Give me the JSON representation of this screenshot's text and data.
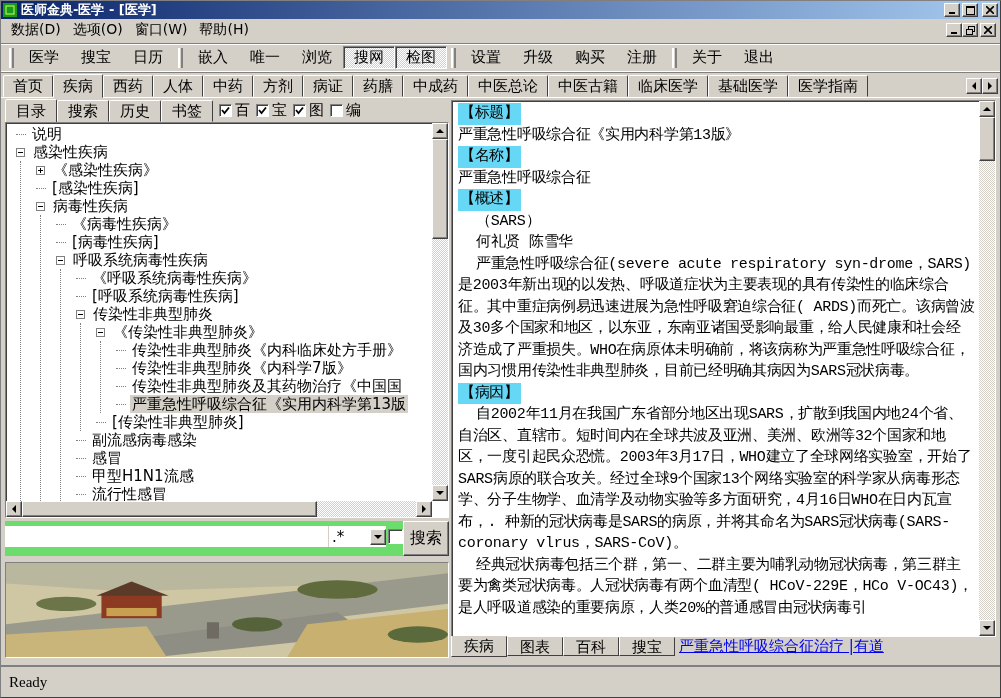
{
  "window": {
    "title": "医师金典-医学 - [医学]"
  },
  "menu": [
    "数据(D)",
    "选项(O)",
    "窗口(W)",
    "帮助(H)"
  ],
  "toolbar": [
    {
      "buttons": [
        {
          "label": "医学",
          "pressed": false
        },
        {
          "label": "搜宝",
          "pressed": false
        },
        {
          "label": "日历",
          "pressed": false
        }
      ]
    },
    {
      "buttons": [
        {
          "label": "嵌入",
          "pressed": false
        },
        {
          "label": "唯一",
          "pressed": false
        },
        {
          "label": "浏览",
          "pressed": false
        },
        {
          "label": "搜网",
          "pressed": true
        },
        {
          "label": "检图",
          "pressed": true
        }
      ]
    },
    {
      "buttons": [
        {
          "label": "设置",
          "pressed": false
        },
        {
          "label": "升级",
          "pressed": false
        },
        {
          "label": "购买",
          "pressed": false
        },
        {
          "label": "注册",
          "pressed": false
        }
      ]
    },
    {
      "buttons": [
        {
          "label": "关于",
          "pressed": false
        },
        {
          "label": "退出",
          "pressed": false
        }
      ]
    }
  ],
  "tabs": [
    {
      "label": "首页",
      "selected": false
    },
    {
      "label": "疾病",
      "selected": true
    },
    {
      "label": "西药",
      "selected": false
    },
    {
      "label": "人体",
      "selected": false
    },
    {
      "label": "中药",
      "selected": false
    },
    {
      "label": "方剂",
      "selected": false
    },
    {
      "label": "病证",
      "selected": false
    },
    {
      "label": "药膳",
      "selected": false
    },
    {
      "label": "中成药",
      "selected": false
    },
    {
      "label": "中医总论",
      "selected": false
    },
    {
      "label": "中医古籍",
      "selected": false
    },
    {
      "label": "临床医学",
      "selected": false
    },
    {
      "label": "基础医学",
      "selected": false
    },
    {
      "label": "医学指南",
      "selected": false
    }
  ],
  "left_tabs": [
    {
      "label": "目录",
      "selected": true
    },
    {
      "label": "搜索",
      "selected": false
    },
    {
      "label": "历史",
      "selected": false
    },
    {
      "label": "书签",
      "selected": false
    }
  ],
  "options": [
    {
      "label": "百",
      "checked": true
    },
    {
      "label": "宝",
      "checked": true
    },
    {
      "label": "图",
      "checked": true
    },
    {
      "label": "编",
      "checked": false
    }
  ],
  "tree": [
    {
      "label": "说明",
      "selected": false
    },
    {
      "label": "感染性疾病",
      "selected": false,
      "expanded": true,
      "children": [
        {
          "label": "《感染性疾病》",
          "selected": false,
          "expanded": false
        },
        {
          "label": "[感染性疾病]",
          "selected": false
        },
        {
          "label": "病毒性疾病",
          "selected": false,
          "expanded": true,
          "children": [
            {
              "label": "《病毒性疾病》",
              "selected": false
            },
            {
              "label": "[病毒性疾病]",
              "selected": false
            },
            {
              "label": "呼吸系统病毒性疾病",
              "selected": false,
              "expanded": true,
              "children": [
                {
                  "label": "《呼吸系统病毒性疾病》",
                  "selected": false
                },
                {
                  "label": "[呼吸系统病毒性疾病]",
                  "selected": false
                },
                {
                  "label": "传染性非典型肺炎",
                  "selected": false,
                  "expanded": true,
                  "children": [
                    {
                      "label": "《传染性非典型肺炎》",
                      "selected": false,
                      "expanded": true,
                      "children": [
                        {
                          "label": "传染性非典型肺炎《内科临床处方手册》",
                          "selected": false
                        },
                        {
                          "label": "传染性非典型肺炎《内科学7版》",
                          "selected": false
                        },
                        {
                          "label": "传染性非典型肺炎及其药物治疗《中国国",
                          "selected": false
                        },
                        {
                          "label": "严重急性呼吸综合征《实用内科学第13版",
                          "selected": true
                        }
                      ]
                    },
                    {
                      "label": "[传染性非典型肺炎]",
                      "selected": false
                    }
                  ]
                },
                {
                  "label": "副流感病毒感染",
                  "selected": false
                },
                {
                  "label": "感冒",
                  "selected": false
                },
                {
                  "label": "甲型H1N1流感",
                  "selected": false
                },
                {
                  "label": "流行性感冒",
                  "selected": false
                }
              ]
            }
          ]
        }
      ]
    }
  ],
  "search": {
    "pattern": ".*",
    "checked": false,
    "button": "搜索"
  },
  "picture": {
    "kind": "picture"
  },
  "article": [
    {
      "heading": "【标题】",
      "paragraphs": [
        {
          "text": "严重急性呼吸综合征《实用内科学第13版》",
          "indent": false
        }
      ]
    },
    {
      "heading": "【名称】",
      "paragraphs": [
        {
          "text": "严重急性呼吸综合征",
          "indent": false
        }
      ]
    },
    {
      "heading": "【概述】",
      "paragraphs": [
        {
          "text": "（SARS）",
          "indent": true
        },
        {
          "text": "何礼贤 陈雪华",
          "indent": true
        },
        {
          "text": "严重急性呼吸综合征(severe acute respiratory syn-drome，SARS)是2003年新出现的以发热、呼吸道症状为主要表现的具有传染性的临床综合征。其中重症病例易迅速进展为急性呼吸窘迫综合征( ARDS)而死亡。该病曾波及30多个国家和地区，以东亚，东南亚诸国受影响最重，给人民健康和社会经济造成了严重损失。WHO在病原体未明确前，将该病称为严重急性呼吸综合征，国内习惯用传染性非典型肺炎，目前已经明确其病因为SARS冠状病毒。",
          "indent": true
        }
      ]
    },
    {
      "heading": "【病因】",
      "paragraphs": [
        {
          "text": "自2002年11月在我国广东省部分地区出现SARS，扩散到我国内地24个省、自治区、直辖市。短时间内在全球共波及亚洲、美洲、欧洲等32个国家和地区，一度引起民众恐慌。2003年3月17日，WHO建立了全球网络实验室，开始了SARS病原的联合攻关。经过全球9个国家13个网络实验室的科学家从病毒形态学、分子生物学、血清学及动物实验等多方面研究，4月16日WHO在日内瓦宣布，. 种新的冠状病毒是SARS的病原，并将其命名为SARS冠状病毒(SARS-coronary vlrus，SARS-CoV)。",
          "indent": true
        },
        {
          "text": "经典冠状病毒包括三个群，第一、二群主要为哺乳动物冠状病毒，第三群主要为禽类冠状病毒。人冠状病毒有两个血清型( HCoV-229E，HCo V-OC43)，是人呼吸道感染的重要病原，人类20%的普通感冒由冠状病毒引",
          "indent": true
        }
      ]
    }
  ],
  "bottom_tabs": [
    {
      "label": "疾病",
      "selected": true
    },
    {
      "label": "图表",
      "selected": false
    },
    {
      "label": "百科",
      "selected": false
    },
    {
      "label": "搜宝",
      "selected": false
    }
  ],
  "link": "严重急性呼吸综合征治疗 |有道",
  "status_bar": "Ready"
}
